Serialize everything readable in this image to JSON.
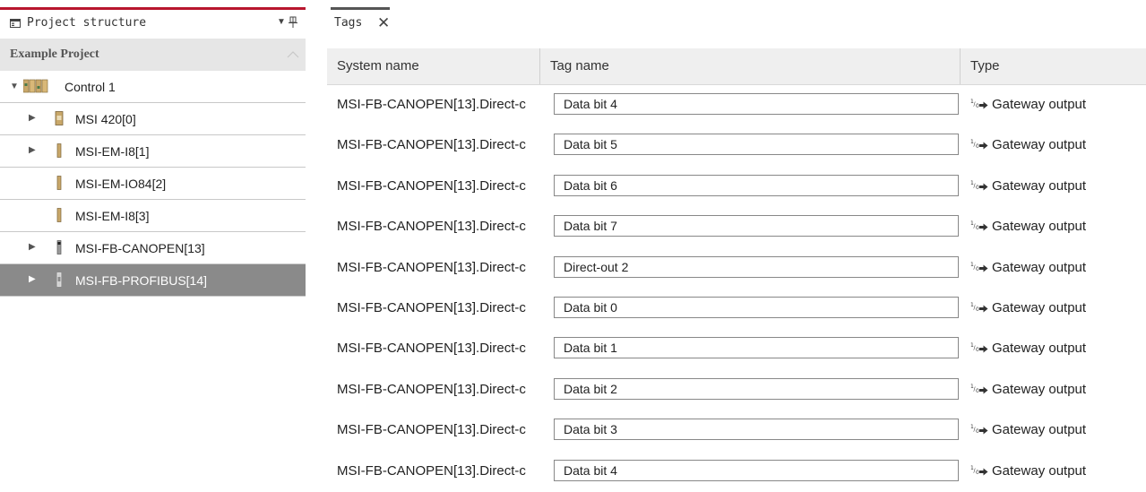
{
  "left_panel": {
    "title": "Project structure",
    "project": "Example Project",
    "tree": [
      {
        "label": "Control 1",
        "expandable": true,
        "expanded": true,
        "level": 0
      },
      {
        "label": "MSI 420[0]",
        "expandable": true,
        "level": 1
      },
      {
        "label": "MSI-EM-I8[1]",
        "expandable": true,
        "level": 1
      },
      {
        "label": "MSI-EM-IO84[2]",
        "expandable": false,
        "level": 1
      },
      {
        "label": "MSI-EM-I8[3]",
        "expandable": false,
        "level": 1
      },
      {
        "label": "MSI-FB-CANOPEN[13]",
        "expandable": true,
        "level": 1
      },
      {
        "label": "MSI-FB-PROFIBUS[14]",
        "expandable": true,
        "level": 1,
        "selected": true
      }
    ]
  },
  "tabs": [
    {
      "label": "Tags"
    }
  ],
  "table": {
    "columns": [
      "System name",
      "Tag name",
      "Type"
    ],
    "rows": [
      {
        "system": "MSI-FB-CANOPEN[13].Direct-c",
        "tag": "Data bit 4",
        "type": "Gateway output"
      },
      {
        "system": "MSI-FB-CANOPEN[13].Direct-c",
        "tag": "Data bit 5",
        "type": "Gateway output"
      },
      {
        "system": "MSI-FB-CANOPEN[13].Direct-c",
        "tag": "Data bit 6",
        "type": "Gateway output"
      },
      {
        "system": "MSI-FB-CANOPEN[13].Direct-c",
        "tag": "Data bit 7",
        "type": "Gateway output"
      },
      {
        "system": "MSI-FB-CANOPEN[13].Direct-c",
        "tag": "Direct-out 2",
        "type": "Gateway output"
      },
      {
        "system": "MSI-FB-CANOPEN[13].Direct-c",
        "tag": "Data bit 0",
        "type": "Gateway output"
      },
      {
        "system": "MSI-FB-CANOPEN[13].Direct-c",
        "tag": "Data bit 1",
        "type": "Gateway output"
      },
      {
        "system": "MSI-FB-CANOPEN[13].Direct-c",
        "tag": "Data bit 2",
        "type": "Gateway output"
      },
      {
        "system": "MSI-FB-CANOPEN[13].Direct-c",
        "tag": "Data bit 3",
        "type": "Gateway output"
      },
      {
        "system": "MSI-FB-CANOPEN[13].Direct-c",
        "tag": "Data bit 4",
        "type": "Gateway output"
      }
    ]
  },
  "colors": {
    "accent": "#b8162e",
    "selected_row": "#8a8a8a",
    "header_bg": "#e6e6e6"
  }
}
